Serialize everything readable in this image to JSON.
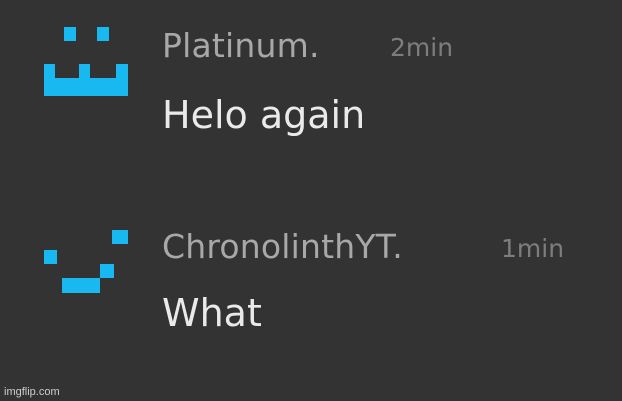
{
  "accent_color": "#17b9f0",
  "messages": [
    {
      "username": "Platinum.",
      "time": "2min",
      "text": "Helo again",
      "avatar_icon": "pixel-smiley-face-icon"
    },
    {
      "username": "ChronolinthYT.",
      "time": "1min",
      "text": "What",
      "avatar_icon": "pixel-smirk-face-icon"
    }
  ],
  "watermark": "imgflip.com"
}
